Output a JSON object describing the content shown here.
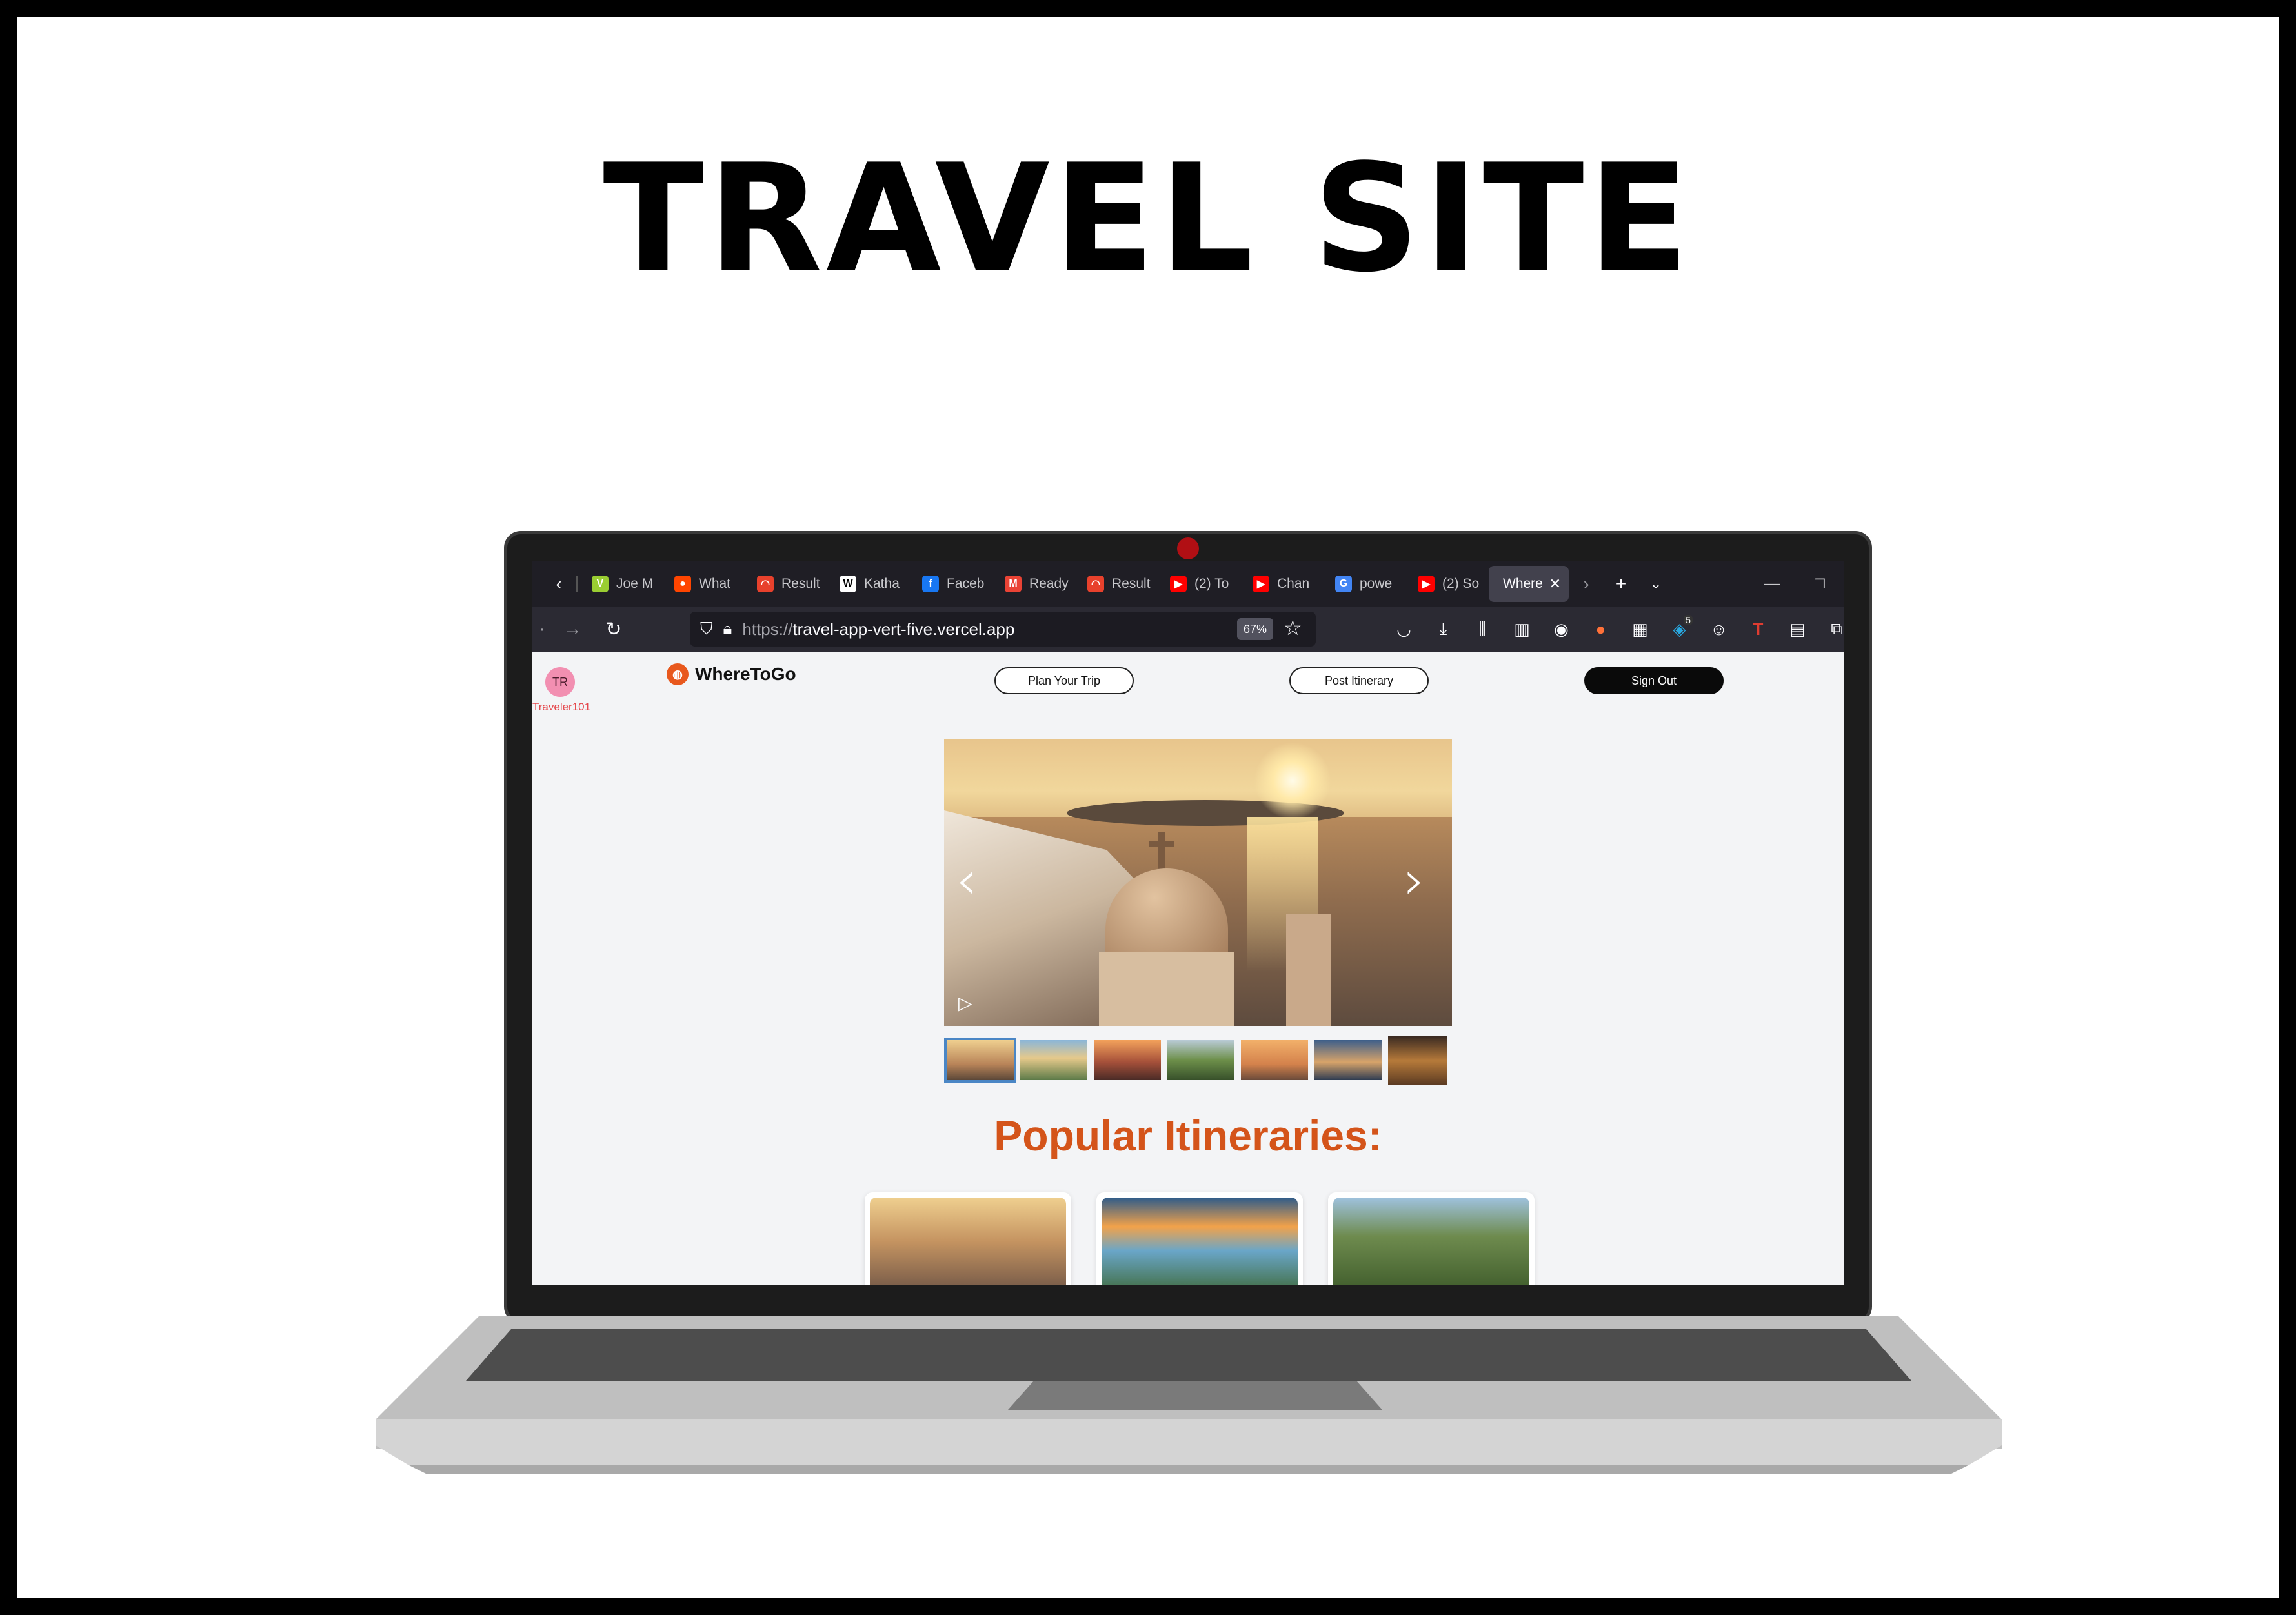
{
  "heading": "TRAVEL SITE",
  "browser": {
    "tabs": [
      {
        "label": "Joe M",
        "icon": "vitally-icon",
        "color": "#9acd32"
      },
      {
        "label": "What",
        "icon": "reddit-icon",
        "color": "#ff4500"
      },
      {
        "label": "Result",
        "icon": "rainbow-icon",
        "color": "#e8412c"
      },
      {
        "label": "Katha",
        "icon": "wikipedia-icon",
        "color": "#ffffff"
      },
      {
        "label": "Faceb",
        "icon": "facebook-icon",
        "color": "#1877f2"
      },
      {
        "label": "Ready",
        "icon": "gmail-icon",
        "color": "#ea4335"
      },
      {
        "label": "Result",
        "icon": "rainbow-icon",
        "color": "#e8412c"
      },
      {
        "label": "(2) To",
        "icon": "youtube-icon",
        "color": "#ff0000"
      },
      {
        "label": "Chan",
        "icon": "youtube-icon",
        "color": "#ff0000"
      },
      {
        "label": "powe",
        "icon": "google-icon",
        "color": "#4285f4"
      },
      {
        "label": "(2) So",
        "icon": "youtube-icon",
        "color": "#ff0000"
      }
    ],
    "active_tab": "Where",
    "url_protocol": "https://",
    "url_host": "travel-app-vert-five.vercel.app",
    "zoom": "67%",
    "extension_badge": "5"
  },
  "site": {
    "avatar_initials": "TR",
    "username": "Traveler101",
    "brand": "WhereToGo",
    "plan_button": "Plan Your Trip",
    "post_button": "Post Itinerary",
    "signout_button": "Sign Out",
    "section_title": "Popular Itineraries:",
    "thumbnails": [
      "santorini",
      "coastal-meadow",
      "canyon-sunset",
      "green-valley",
      "eiffel-tower",
      "harbor-town",
      "temple-ruins"
    ],
    "active_thumbnail": 0,
    "cards": [
      "santorini",
      "mountain-lake",
      "machu-picchu"
    ]
  },
  "colors": {
    "brand_orange": "#d4541a",
    "accent_pink": "#e5484d",
    "browser_dark": "#1f1e25"
  }
}
